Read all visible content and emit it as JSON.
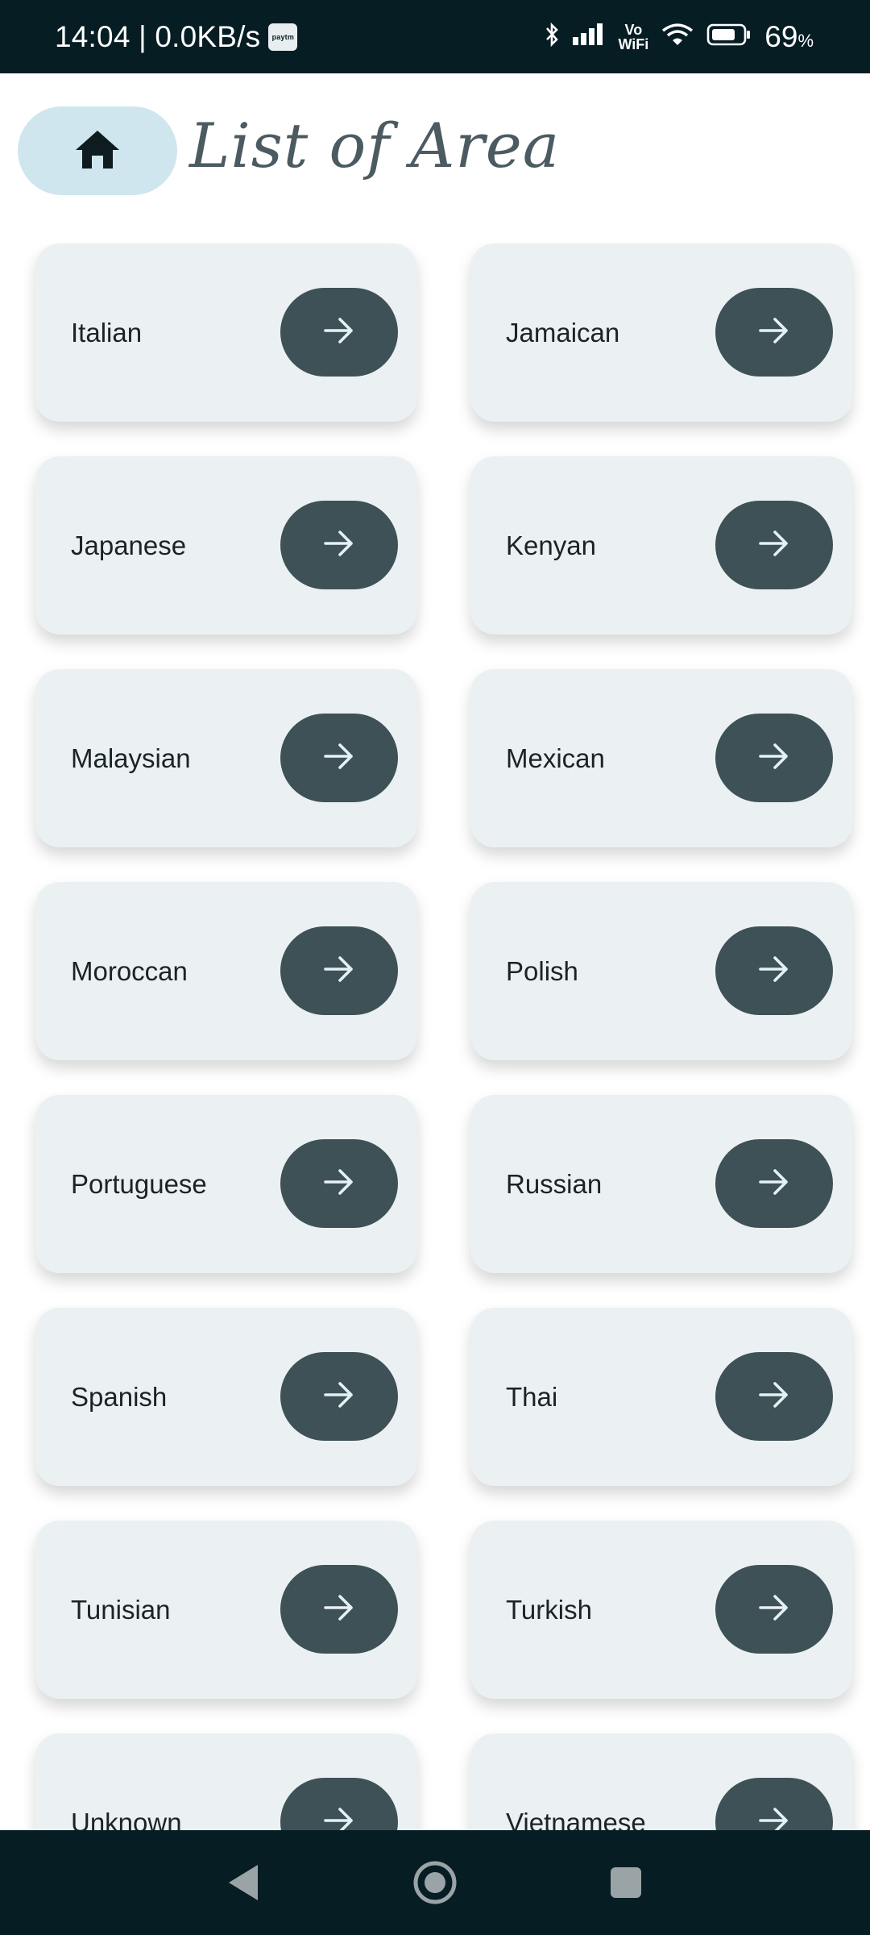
{
  "status_bar": {
    "time_speed": "14:04 | 0.0KB/s",
    "paytm_icon_text": "paytm",
    "vo_label": "Vo",
    "wifi_label": "WiFi",
    "battery_percent": "69",
    "battery_unit": "%"
  },
  "header": {
    "title": "List of Area",
    "home_icon": "home-icon"
  },
  "areas": [
    "Italian",
    "Jamaican",
    "Japanese",
    "Kenyan",
    "Malaysian",
    "Mexican",
    "Moroccan",
    "Polish",
    "Portuguese",
    "Russian",
    "Spanish",
    "Thai",
    "Tunisian",
    "Turkish",
    "Unknown",
    "Vietnamese"
  ],
  "item_icon": "arrow-right-icon",
  "colors": {
    "status_bar": "#061d24",
    "home_button": "#cfe6ee",
    "card": "#ebf1f2",
    "arrow_button": "#3e5157",
    "title": "#4b5b61"
  }
}
